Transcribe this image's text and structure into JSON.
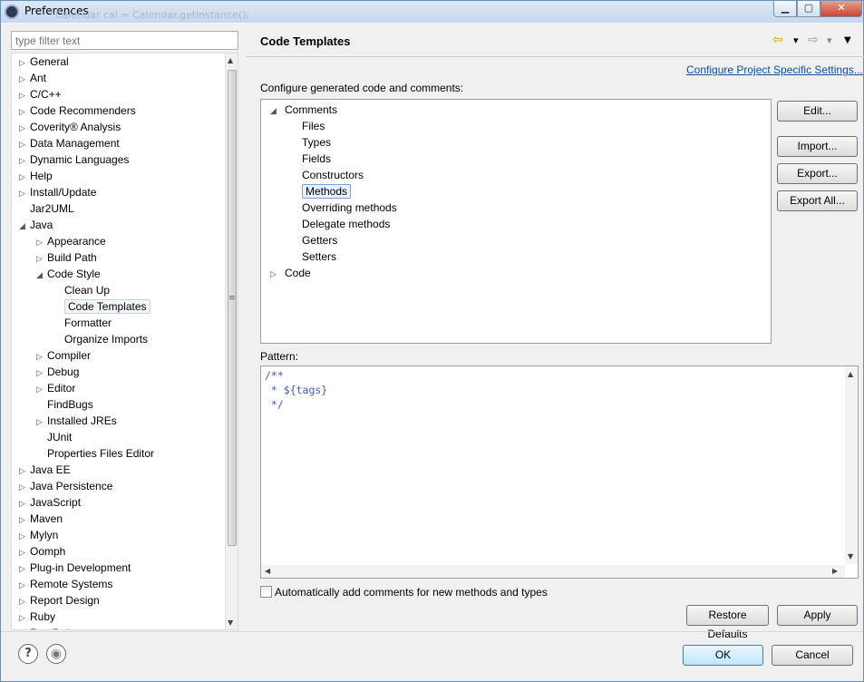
{
  "window": {
    "title": "Preferences",
    "ghost_title": "Calendar cal = Calendar.getInstance();",
    "min_icon": "minimize-icon",
    "max_icon": "maximize-icon",
    "close_glyph": "✕"
  },
  "filter": {
    "placeholder": "type filter text"
  },
  "tree": {
    "items": [
      {
        "label": "General",
        "indent": 0,
        "arrow": "▷"
      },
      {
        "label": "Ant",
        "indent": 0,
        "arrow": "▷"
      },
      {
        "label": "C/C++",
        "indent": 0,
        "arrow": "▷"
      },
      {
        "label": "Code Recommenders",
        "indent": 0,
        "arrow": "▷"
      },
      {
        "label": "Coverity® Analysis",
        "indent": 0,
        "arrow": "▷"
      },
      {
        "label": "Data Management",
        "indent": 0,
        "arrow": "▷"
      },
      {
        "label": "Dynamic Languages",
        "indent": 0,
        "arrow": "▷"
      },
      {
        "label": "Help",
        "indent": 0,
        "arrow": "▷"
      },
      {
        "label": "Install/Update",
        "indent": 0,
        "arrow": "▷"
      },
      {
        "label": "Jar2UML",
        "indent": 0,
        "arrow": ""
      },
      {
        "label": "Java",
        "indent": 0,
        "arrow": "◢"
      },
      {
        "label": "Appearance",
        "indent": 1,
        "arrow": "▷"
      },
      {
        "label": "Build Path",
        "indent": 1,
        "arrow": "▷"
      },
      {
        "label": "Code Style",
        "indent": 1,
        "arrow": "◢"
      },
      {
        "label": "Clean Up",
        "indent": 2,
        "arrow": ""
      },
      {
        "label": "Code Templates",
        "indent": 2,
        "arrow": "",
        "selected": true
      },
      {
        "label": "Formatter",
        "indent": 2,
        "arrow": ""
      },
      {
        "label": "Organize Imports",
        "indent": 2,
        "arrow": ""
      },
      {
        "label": "Compiler",
        "indent": 1,
        "arrow": "▷"
      },
      {
        "label": "Debug",
        "indent": 1,
        "arrow": "▷"
      },
      {
        "label": "Editor",
        "indent": 1,
        "arrow": "▷"
      },
      {
        "label": "FindBugs",
        "indent": 1,
        "arrow": ""
      },
      {
        "label": "Installed JREs",
        "indent": 1,
        "arrow": "▷"
      },
      {
        "label": "JUnit",
        "indent": 1,
        "arrow": ""
      },
      {
        "label": "Properties Files Editor",
        "indent": 1,
        "arrow": ""
      },
      {
        "label": "Java EE",
        "indent": 0,
        "arrow": "▷"
      },
      {
        "label": "Java Persistence",
        "indent": 0,
        "arrow": "▷"
      },
      {
        "label": "JavaScript",
        "indent": 0,
        "arrow": "▷"
      },
      {
        "label": "Maven",
        "indent": 0,
        "arrow": "▷"
      },
      {
        "label": "Mylyn",
        "indent": 0,
        "arrow": "▷"
      },
      {
        "label": "Oomph",
        "indent": 0,
        "arrow": "▷"
      },
      {
        "label": "Plug-in Development",
        "indent": 0,
        "arrow": "▷"
      },
      {
        "label": "Remote Systems",
        "indent": 0,
        "arrow": "▷"
      },
      {
        "label": "Report Design",
        "indent": 0,
        "arrow": "▷"
      },
      {
        "label": "Ruby",
        "indent": 0,
        "arrow": "▷"
      },
      {
        "label": "Run/Debug",
        "indent": 0,
        "arrow": "▷"
      }
    ]
  },
  "page": {
    "title": "Code Templates",
    "nav": {
      "back": "⇦",
      "back_menu": "▾",
      "forward": "⇨",
      "forward_menu": "▾",
      "view_menu": "▼"
    },
    "configure_link": "Configure Project Specific Settings...",
    "configure_label": "Configure generated code and comments:",
    "templates": [
      {
        "label": "Comments",
        "level": 0,
        "arrow": "◢"
      },
      {
        "label": "Files",
        "level": 1,
        "arrow": ""
      },
      {
        "label": "Types",
        "level": 1,
        "arrow": ""
      },
      {
        "label": "Fields",
        "level": 1,
        "arrow": ""
      },
      {
        "label": "Constructors",
        "level": 1,
        "arrow": ""
      },
      {
        "label": "Methods",
        "level": 1,
        "arrow": "",
        "selected": true
      },
      {
        "label": "Overriding methods",
        "level": 1,
        "arrow": ""
      },
      {
        "label": "Delegate methods",
        "level": 1,
        "arrow": ""
      },
      {
        "label": "Getters",
        "level": 1,
        "arrow": ""
      },
      {
        "label": "Setters",
        "level": 1,
        "arrow": ""
      },
      {
        "label": "Code",
        "level": 0,
        "arrow": "▷"
      }
    ],
    "side_buttons": [
      "Edit...",
      "Import...",
      "Export...",
      "Export All..."
    ],
    "pattern_label": "Pattern:",
    "pattern_lines": [
      "/**",
      " * ${tags}",
      " */"
    ],
    "auto_comment_label": "Automatically add comments for new methods and types",
    "auto_comment_checked": false,
    "restore_defaults": "Restore Defaults",
    "apply": "Apply"
  },
  "footer": {
    "help_glyph": "?",
    "record_glyph": "◉",
    "ok": "OK",
    "cancel": "Cancel"
  },
  "colors": {
    "link": "#0b4ea2",
    "code_comment": "#3f5fbf",
    "default_button": "#bee6fd"
  }
}
